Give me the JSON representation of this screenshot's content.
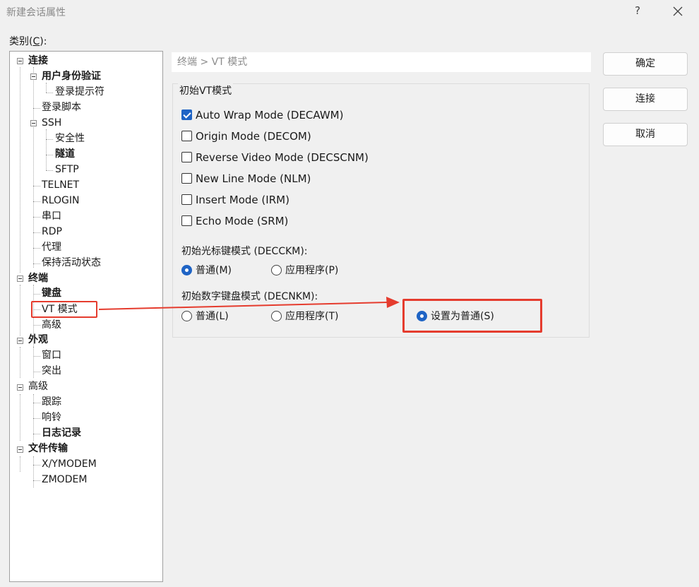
{
  "window": {
    "title": "新建会话属性",
    "help_label": "?"
  },
  "category": {
    "label_prefix": "类别(",
    "label_key": "C",
    "label_suffix": "):"
  },
  "tree": {
    "nodes": [
      {
        "label": "连接",
        "bold": true,
        "expanded": true
      },
      {
        "label": "用户身份验证",
        "bold": true,
        "expanded": true
      },
      {
        "label": "登录提示符",
        "bold": false
      },
      {
        "label": "登录脚本",
        "bold": false
      },
      {
        "label": "SSH",
        "bold": false,
        "expanded": true
      },
      {
        "label": "安全性",
        "bold": false
      },
      {
        "label": "隧道",
        "bold": true
      },
      {
        "label": "SFTP",
        "bold": false
      },
      {
        "label": "TELNET",
        "bold": false
      },
      {
        "label": "RLOGIN",
        "bold": false
      },
      {
        "label": "串口",
        "bold": false
      },
      {
        "label": "RDP",
        "bold": false
      },
      {
        "label": "代理",
        "bold": false
      },
      {
        "label": "保持活动状态",
        "bold": false
      },
      {
        "label": "终端",
        "bold": true,
        "expanded": true
      },
      {
        "label": "键盘",
        "bold": true
      },
      {
        "label": "VT 模式",
        "bold": false,
        "selected": true
      },
      {
        "label": "高级",
        "bold": false
      },
      {
        "label": "外观",
        "bold": true,
        "expanded": true
      },
      {
        "label": "窗口",
        "bold": false
      },
      {
        "label": "突出",
        "bold": false
      },
      {
        "label": "高级",
        "bold": false,
        "expanded": true
      },
      {
        "label": "跟踪",
        "bold": false
      },
      {
        "label": "响铃",
        "bold": false
      },
      {
        "label": "日志记录",
        "bold": true
      },
      {
        "label": "文件传输",
        "bold": true,
        "expanded": true
      },
      {
        "label": "X/YMODEM",
        "bold": false
      },
      {
        "label": "ZMODEM",
        "bold": false
      }
    ]
  },
  "panel": {
    "breadcrumb": "终端 > VT 模式",
    "group_title": "初始VT模式",
    "checkboxes": [
      {
        "label": "Auto Wrap Mode (DECAWM)",
        "checked": true
      },
      {
        "label": "Origin Mode (DECOM)",
        "checked": false
      },
      {
        "label": "Reverse Video Mode (DECSCNM)",
        "checked": false
      },
      {
        "label": "New Line Mode (NLM)",
        "checked": false
      },
      {
        "label": "Insert Mode (IRM)",
        "checked": false
      },
      {
        "label": "Echo Mode (SRM)",
        "checked": false
      }
    ],
    "cursor_keys": {
      "label": "初始光标键模式 (DECCKM):",
      "options": [
        {
          "label": "普通(M)",
          "selected": true
        },
        {
          "label": "应用程序(P)",
          "selected": false
        }
      ]
    },
    "keypad": {
      "label": "初始数字键盘模式 (DECNKM):",
      "options": [
        {
          "label": "普通(L)",
          "selected": false
        },
        {
          "label": "应用程序(T)",
          "selected": false
        },
        {
          "label": "设置为普通(S)",
          "selected": true
        }
      ]
    }
  },
  "buttons": {
    "ok": "确定",
    "connect": "连接",
    "cancel": "取消"
  },
  "colors": {
    "accent": "#1f64c5",
    "annotation": "#e53c2e"
  }
}
